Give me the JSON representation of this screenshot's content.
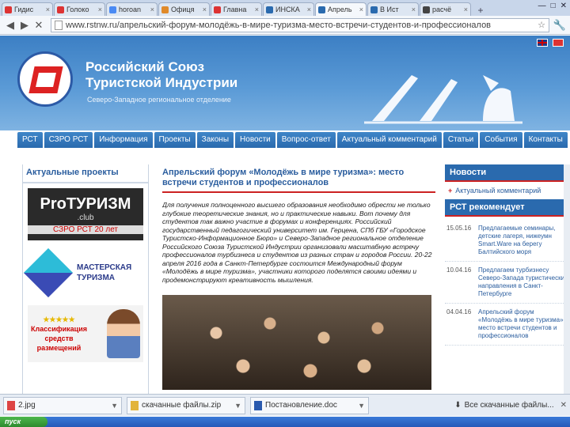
{
  "browser": {
    "tabs": [
      {
        "title": "Гидис",
        "color": "#d33"
      },
      {
        "title": "Голоко",
        "color": "#d33"
      },
      {
        "title": "horoan",
        "color": "#4a8af4"
      },
      {
        "title": "Офиця",
        "color": "#e08a2a"
      },
      {
        "title": "Главна",
        "color": "#d33"
      },
      {
        "title": "ИНСКА",
        "color": "#2a6aae"
      },
      {
        "title": "Апрель",
        "color": "#2a6aae",
        "active": true
      },
      {
        "title": "В Ист",
        "color": "#2a6aae"
      },
      {
        "title": "расчё",
        "color": "#444"
      }
    ],
    "url": "www.rstnw.ru/апрельский-форум-молодёжь-в-мире-туризма-место-встречи-студентов-и-профессионалов"
  },
  "site": {
    "org_title_line1": "Российский Союз",
    "org_title_line2": "Туристской Индустрии",
    "org_subtitle": "Северо-Западное региональное отделение"
  },
  "nav": [
    "РСТ",
    "СЗРО РСТ",
    "Информация",
    "Проекты",
    "Законы",
    "Новости",
    "Вопрос-ответ",
    "Актуальный комментарий",
    "Статьи",
    "События",
    "Контакты"
  ],
  "left": {
    "heading": "Актуальные проекты",
    "pro": {
      "title": "ProТУРИЗМ",
      "sub": ".club",
      "footer": "СЗРО РСТ 20 лет"
    },
    "mt": {
      "line1": "МАСТЕРСКАЯ",
      "line2": "ТУРИЗМА"
    },
    "cl": {
      "stars": "★★★★★",
      "line1": "Классификация",
      "line2": "средств",
      "line3": "размещений"
    }
  },
  "article": {
    "title": "Апрельский форум «Молодёжь в мире туризма»: место встречи студентов и профессионалов",
    "body": "Для получения полноценного высшего образования необходимо обрести не только глубокие теоретические знания, но и практические навыки. Вот почему для студентов так важно участие в форумах и конференциях. Российский государственный педагогический университет им. Герцена, СПб ГБУ «Городское Туристско-Информационное Бюро» и Северо-Западное региональное отделение Российского Союза Туристской Индустрии организовали масштабную встречу профессионалов турбизнеса и студентов из разных стран и городов России. 20-22 апреля 2016 года в Санкт-Петербурге состоится Международный форум «Молодёжь в мире туризма», участники которого поделятся своими идеями и продемонстрируют креативность мышления."
  },
  "right": {
    "news_heading": "Новости",
    "news_item": "Актуальный комментарий",
    "rec_heading": "РСТ рекомендует",
    "recs": [
      {
        "date": "15.05.16",
        "text": "Предлагаемые семинары, детские лагеря, нижеумн Smart.Ware на берегу Балтийского моря"
      },
      {
        "date": "10.04.16",
        "text": "Предлагаем турбизнесу Северо-Запада туристические направления в Санкт-Петербурге"
      },
      {
        "date": "04.04.16",
        "text": "Апрельский форум «Молодёжь в мире туризма»: место встречи студентов и профессионалов"
      }
    ]
  },
  "downloads": {
    "items": [
      "2.jpg",
      "скачанные файлы.zip",
      "Постановление.doc"
    ],
    "show_all": "Все скачанные файлы..."
  },
  "taskbar": {
    "start": "пуск"
  }
}
